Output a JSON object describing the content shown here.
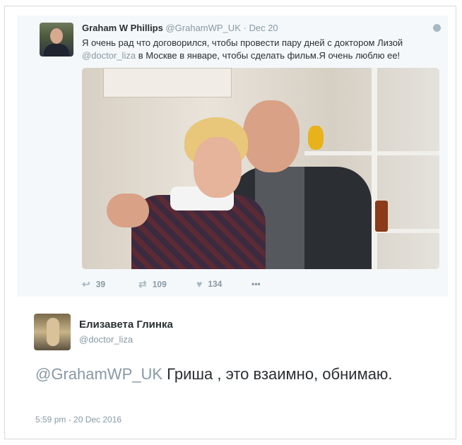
{
  "quoted_tweet": {
    "author_name": "Graham W Phillips",
    "author_handle": "@GrahamWP_UK",
    "separator": "·",
    "date": "Dec 20",
    "text_part1": "Я очень рад что договорился, чтобы провести пару дней с доктором Лизой",
    "mention": "@doctor_liza",
    "text_part2": " в Москве в январе, чтобы сделать фильм.Я очень люблю ее!",
    "actions": {
      "reply_count": "39",
      "retweet_count": "109",
      "like_count": "134",
      "more_label": "•••"
    },
    "icons": {
      "reply": "reply-arrow-icon",
      "retweet": "retweet-icon",
      "like": "heart-icon",
      "globe": "globe-icon"
    }
  },
  "reply_tweet": {
    "author_name": "Елизавета Глинка",
    "author_handle": "@doctor_liza",
    "mention": "@GrahamWP_UK",
    "text": " Гриша , это взаимно, обнимаю.",
    "timestamp": "5:59 pm - 20 Dec 2016"
  }
}
